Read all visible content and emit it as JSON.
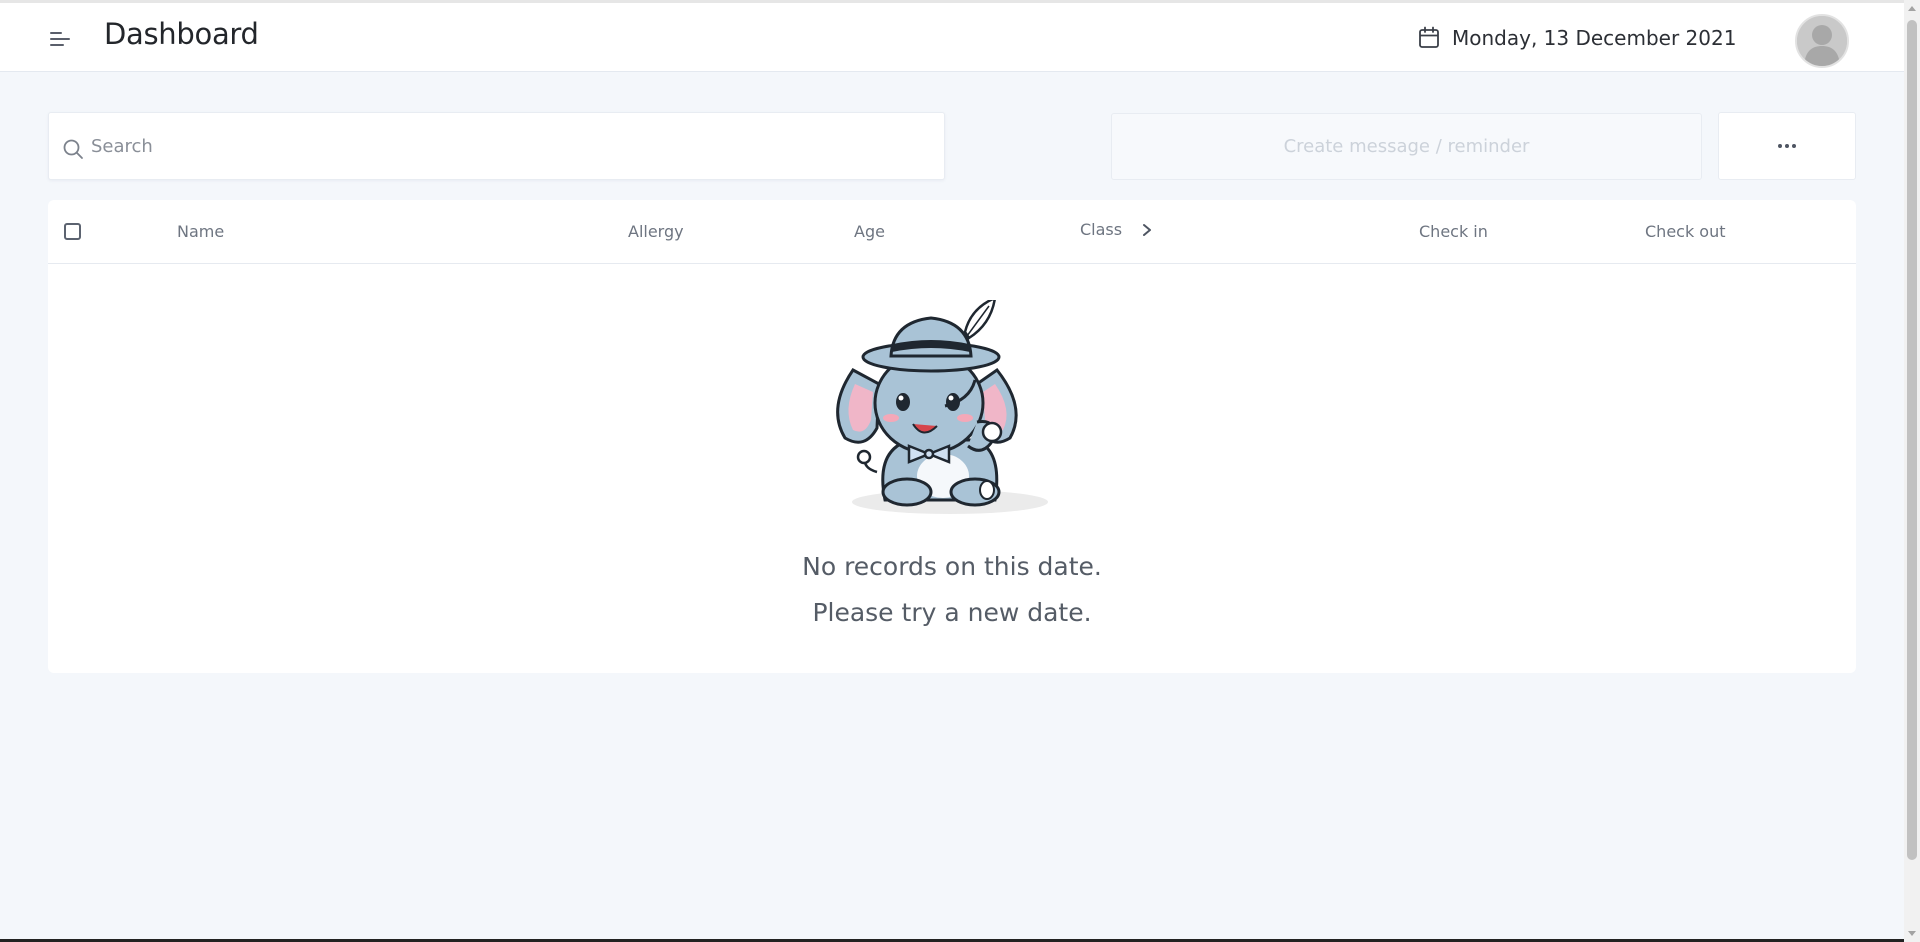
{
  "header": {
    "title": "Dashboard",
    "date": "Monday, 13 December 2021",
    "icons": {
      "menu": "menu-icon",
      "calendar": "calendar-icon",
      "avatar": "user-avatar"
    }
  },
  "toolbar": {
    "search_placeholder": "Search",
    "search_value": "",
    "create_label": "Create message / reminder",
    "create_enabled": false,
    "more_icon": "more-horizontal-icon"
  },
  "table": {
    "columns": [
      "Name",
      "Allergy",
      "Age",
      "Class",
      "Check in",
      "Check out"
    ],
    "rows": []
  },
  "empty_state": {
    "line1": "No records on this date.",
    "line2": "Please try a new date.",
    "illustration": "elephant-with-hat-illustration"
  },
  "colors": {
    "background": "#f4f7fb",
    "card": "#ffffff",
    "text_primary": "#23262b",
    "text_muted": "#6e7581",
    "disabled_text": "#ccd2da",
    "elephant": "#a9c3d6"
  }
}
